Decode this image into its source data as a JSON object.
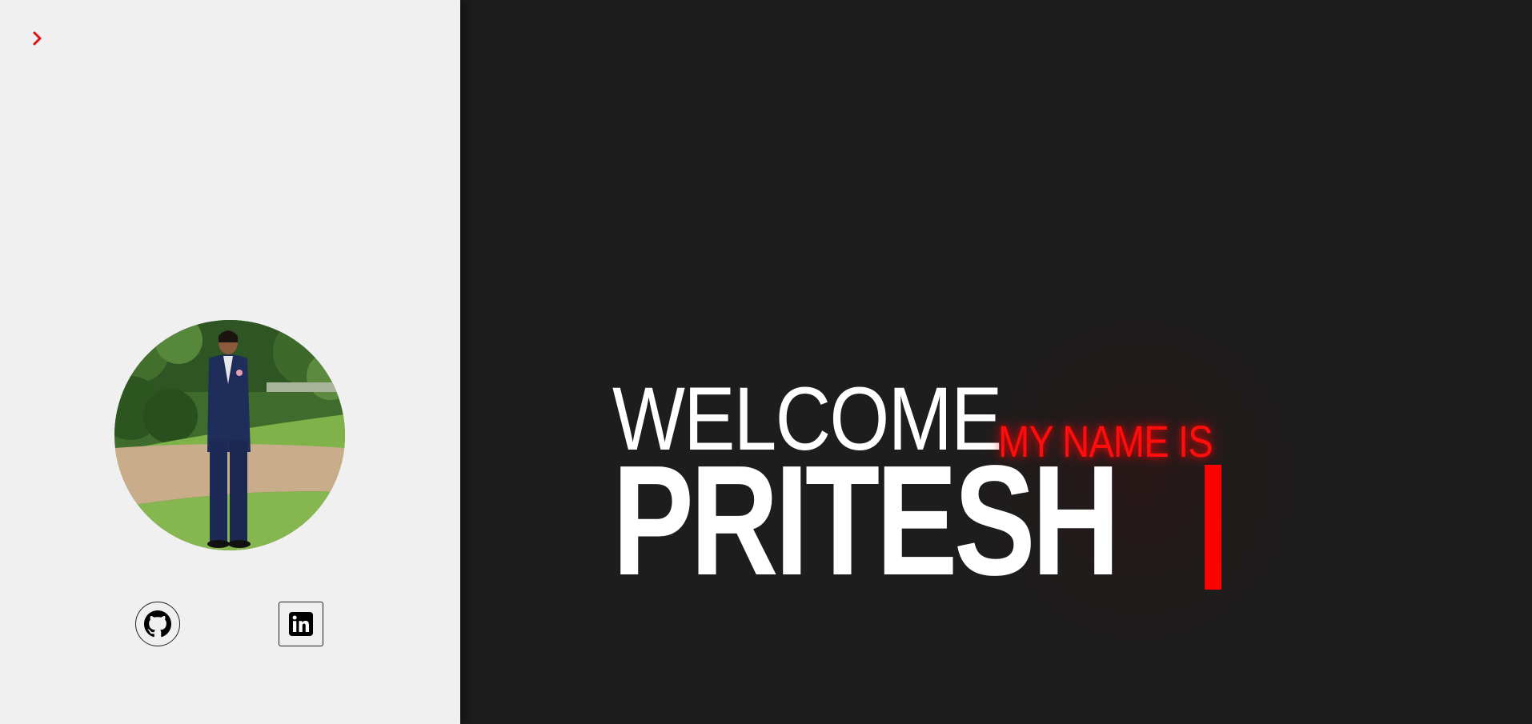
{
  "sidebar": {
    "toggle_icon": "chevron-right-icon",
    "avatar_alt": "Profile photo",
    "social": [
      {
        "icon": "github-icon"
      },
      {
        "icon": "linkedin-icon"
      }
    ]
  },
  "hero": {
    "welcome": "WELCOME",
    "intro": "MY NAME IS",
    "name": "PRITESH"
  },
  "colors": {
    "accent": "#ff0d0d",
    "hero_background": "#1d1d1d",
    "sidebar_background": "#f0f0f0",
    "text_primary": "#ffffff"
  }
}
